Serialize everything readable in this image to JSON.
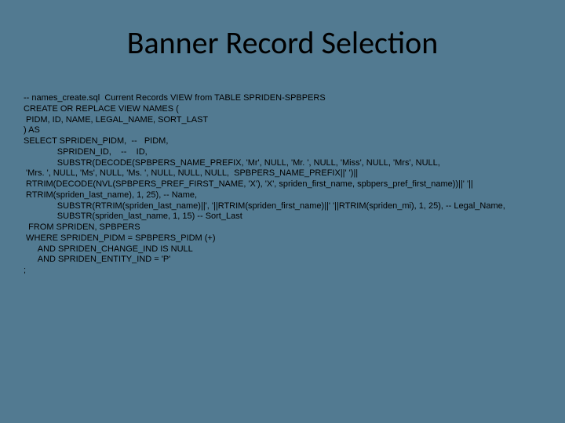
{
  "title": "Banner Record Selection",
  "code_lines": [
    "-- names_create.sql  Current Records VIEW from TABLE SPRIDEN-SPBPERS",
    "CREATE OR REPLACE VIEW NAMES (",
    " PIDM, ID, NAME, LEGAL_NAME, SORT_LAST",
    ") AS",
    "SELECT SPRIDEN_PIDM,  --   PIDM,",
    "              SPRIDEN_ID,    --    ID,",
    "              SUBSTR(DECODE(SPBPERS_NAME_PREFIX, 'Mr', NULL, 'Mr. ', NULL, 'Miss', NULL, 'Mrs', NULL,",
    " 'Mrs. ', NULL, 'Ms', NULL, 'Ms. ', NULL, NULL, NULL,  SPBPERS_NAME_PREFIX||' ')||",
    " RTRIM(DECODE(NVL(SPBPERS_PREF_FIRST_NAME, 'X'), 'X', spriden_first_name, spbpers_pref_first_name))||' '||",
    " RTRIM(spriden_last_name), 1, 25), -- Name,",
    "              SUBSTR(RTRIM(spriden_last_name)||', '||RTRIM(spriden_first_name)||' '||RTRIM(spriden_mi), 1, 25), -- Legal_Name,",
    "              SUBSTR(spriden_last_name, 1, 15) -- Sort_Last",
    "  FROM SPRIDEN, SPBPERS",
    " WHERE SPRIDEN_PIDM = SPBPERS_PIDM (+)",
    "      AND SPRIDEN_CHANGE_IND IS NULL",
    "      AND SPRIDEN_ENTITY_IND = 'P'",
    ";"
  ]
}
